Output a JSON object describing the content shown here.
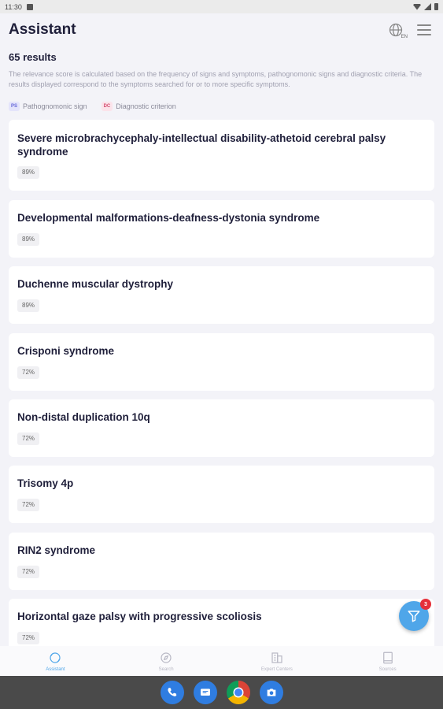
{
  "status_bar": {
    "time": "11:30"
  },
  "header": {
    "title": "Assistant",
    "language": "EN"
  },
  "results": {
    "count_label": "65 results",
    "description": "The relevance score is calculated based on the frequency of signs and symptoms, pathognomonic signs and diagnostic criteria. The results displayed correspond to the symptoms searched for or to more specific symptoms."
  },
  "legend": {
    "pathognomonic": {
      "badge": "PS",
      "label": "Pathognomonic sign"
    },
    "diagnostic": {
      "badge": "DC",
      "label": "Diagnostic criterion"
    }
  },
  "cards": [
    {
      "title": "Severe microbrachycephaly-intellectual disability-athetoid cerebral palsy syndrome",
      "score": "89%"
    },
    {
      "title": "Developmental malformations-deafness-dystonia syndrome",
      "score": "89%"
    },
    {
      "title": "Duchenne muscular dystrophy",
      "score": "89%"
    },
    {
      "title": "Crisponi syndrome",
      "score": "72%"
    },
    {
      "title": "Non-distal duplication 10q",
      "score": "72%"
    },
    {
      "title": "Trisomy 4p",
      "score": "72%"
    },
    {
      "title": "RIN2 syndrome",
      "score": "72%"
    },
    {
      "title": "Horizontal gaze palsy with progressive scoliosis",
      "score": "72%"
    }
  ],
  "fab": {
    "badge_count": "3",
    "icon": "filter-icon"
  },
  "bottom_nav": [
    {
      "label": "Assistant",
      "icon": "assistant-icon",
      "active": true
    },
    {
      "label": "Search",
      "icon": "compass-icon",
      "active": false
    },
    {
      "label": "Expert Centers",
      "icon": "building-icon",
      "active": false
    },
    {
      "label": "Sources",
      "icon": "book-icon",
      "active": false
    }
  ],
  "dock": [
    {
      "icon": "phone-icon"
    },
    {
      "icon": "messages-icon"
    },
    {
      "icon": "chrome-icon"
    },
    {
      "icon": "camera-icon"
    }
  ],
  "colors": {
    "accent": "#4fa6e9",
    "badge_red": "#e5303a",
    "background": "#f3f3f8"
  }
}
